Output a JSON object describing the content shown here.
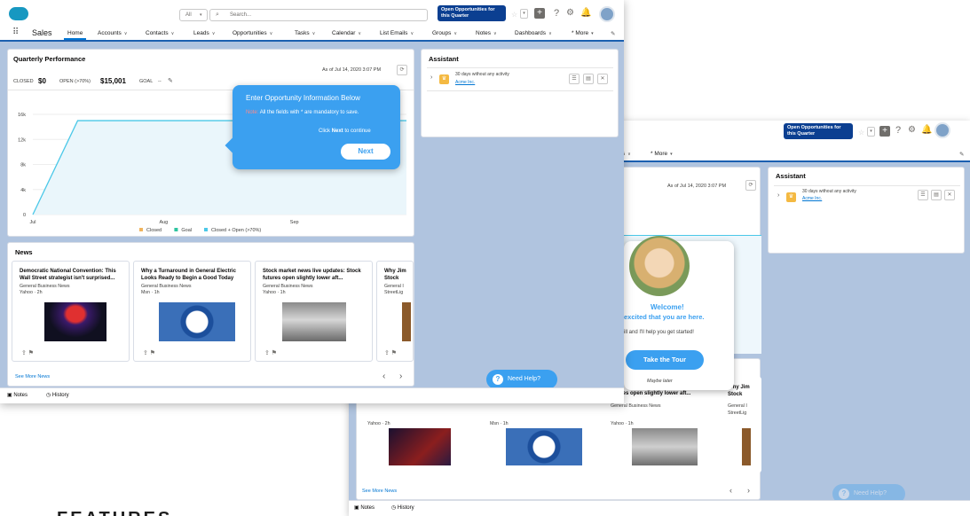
{
  "header": {
    "search_scope": "All",
    "search_placeholder": "Search...",
    "opportunity_button": "Open Opportunities for this Quarter"
  },
  "nav": {
    "app_name": "Sales",
    "items": [
      "Home",
      "Accounts",
      "Contacts",
      "Leads",
      "Opportunities",
      "Tasks",
      "Calendar",
      "List Emails",
      "Groups",
      "Notes",
      "Dashboards",
      "* More"
    ]
  },
  "performance": {
    "title": "Quarterly Performance",
    "as_of": "As of Jul 14, 2020 3:07 PM",
    "closed_label": "CLOSED",
    "closed_value": "$0",
    "open_label": "OPEN (>70%)",
    "open_value": "$15,001",
    "goal_label": "GOAL",
    "goal_value": "--"
  },
  "chart_data": {
    "type": "line",
    "x": [
      "Jul",
      "Aug",
      "Sep"
    ],
    "yticks": [
      "16k",
      "12k",
      "8k",
      "4k",
      "0"
    ],
    "ylim": [
      0,
      16000
    ],
    "series": [
      {
        "name": "Closed",
        "color": "#f0b45e",
        "points": []
      },
      {
        "name": "Goal",
        "color": "#2ec4a0",
        "points": []
      },
      {
        "name": "Closed + Open (>70%)",
        "color": "#4bc8e8",
        "points": [
          [
            0,
            0
          ],
          [
            0.12,
            15001
          ],
          [
            1,
            15001
          ]
        ]
      }
    ],
    "legend_position": "bottom"
  },
  "tooltip": {
    "title": "Enter Opportunity Information Below",
    "note_label": "Note:",
    "note_text": "All the fields with * are mandatory to save.",
    "hint_pre": "Click",
    "hint_bold": "Next",
    "hint_post": "to continue",
    "next_button": "Next"
  },
  "assistant": {
    "title": "Assistant",
    "item_text": "30 days without any activity",
    "item_link": "Acme Inc."
  },
  "news": {
    "title": "News",
    "see_more": "See More News",
    "items": [
      {
        "headline": "Democratic National Convention: This Wall Street strategist isn't surprised...",
        "source": "General Business News",
        "meta": "Yahoo · 2h"
      },
      {
        "headline": "Why a Turnaround in General Electric Looks Ready to Begin a Good Today",
        "source": "General Business News",
        "meta": "Msn · 1h"
      },
      {
        "headline": "Stock market news live updates: Stock futures open slightly lower aft...",
        "source": "General Business News",
        "meta": "Yahoo · 1h"
      },
      {
        "headline": "Why Jim Stock",
        "source": "General I",
        "meta": "StreetLig"
      }
    ]
  },
  "back_news": {
    "items": [
      {
        "meta": "Yahoo · 2h"
      },
      {
        "meta": "Msn · 1h"
      },
      {
        "headline": "futures open slightly lower aft...",
        "source": "General Business News",
        "meta": "Yahoo · 1h"
      },
      {
        "headline": "Why Jim Stock",
        "source": "General I",
        "meta": "StreetLig"
      }
    ]
  },
  "welcome": {
    "title": "Welcome!",
    "subtitle": "excited that you are here.",
    "body": "ill and I'll help you get started!",
    "tour_button": "Take the Tour",
    "later": "Maybe later"
  },
  "help": {
    "label": "Need Help?"
  },
  "footer": {
    "notes": "Notes",
    "history": "History"
  },
  "caption": {
    "text": "FEATURES"
  },
  "colors": {
    "brand": "#0176d3",
    "tooltip": "#3ba0f0",
    "navy": "#0b3f91",
    "bg": "#b0c4df"
  }
}
